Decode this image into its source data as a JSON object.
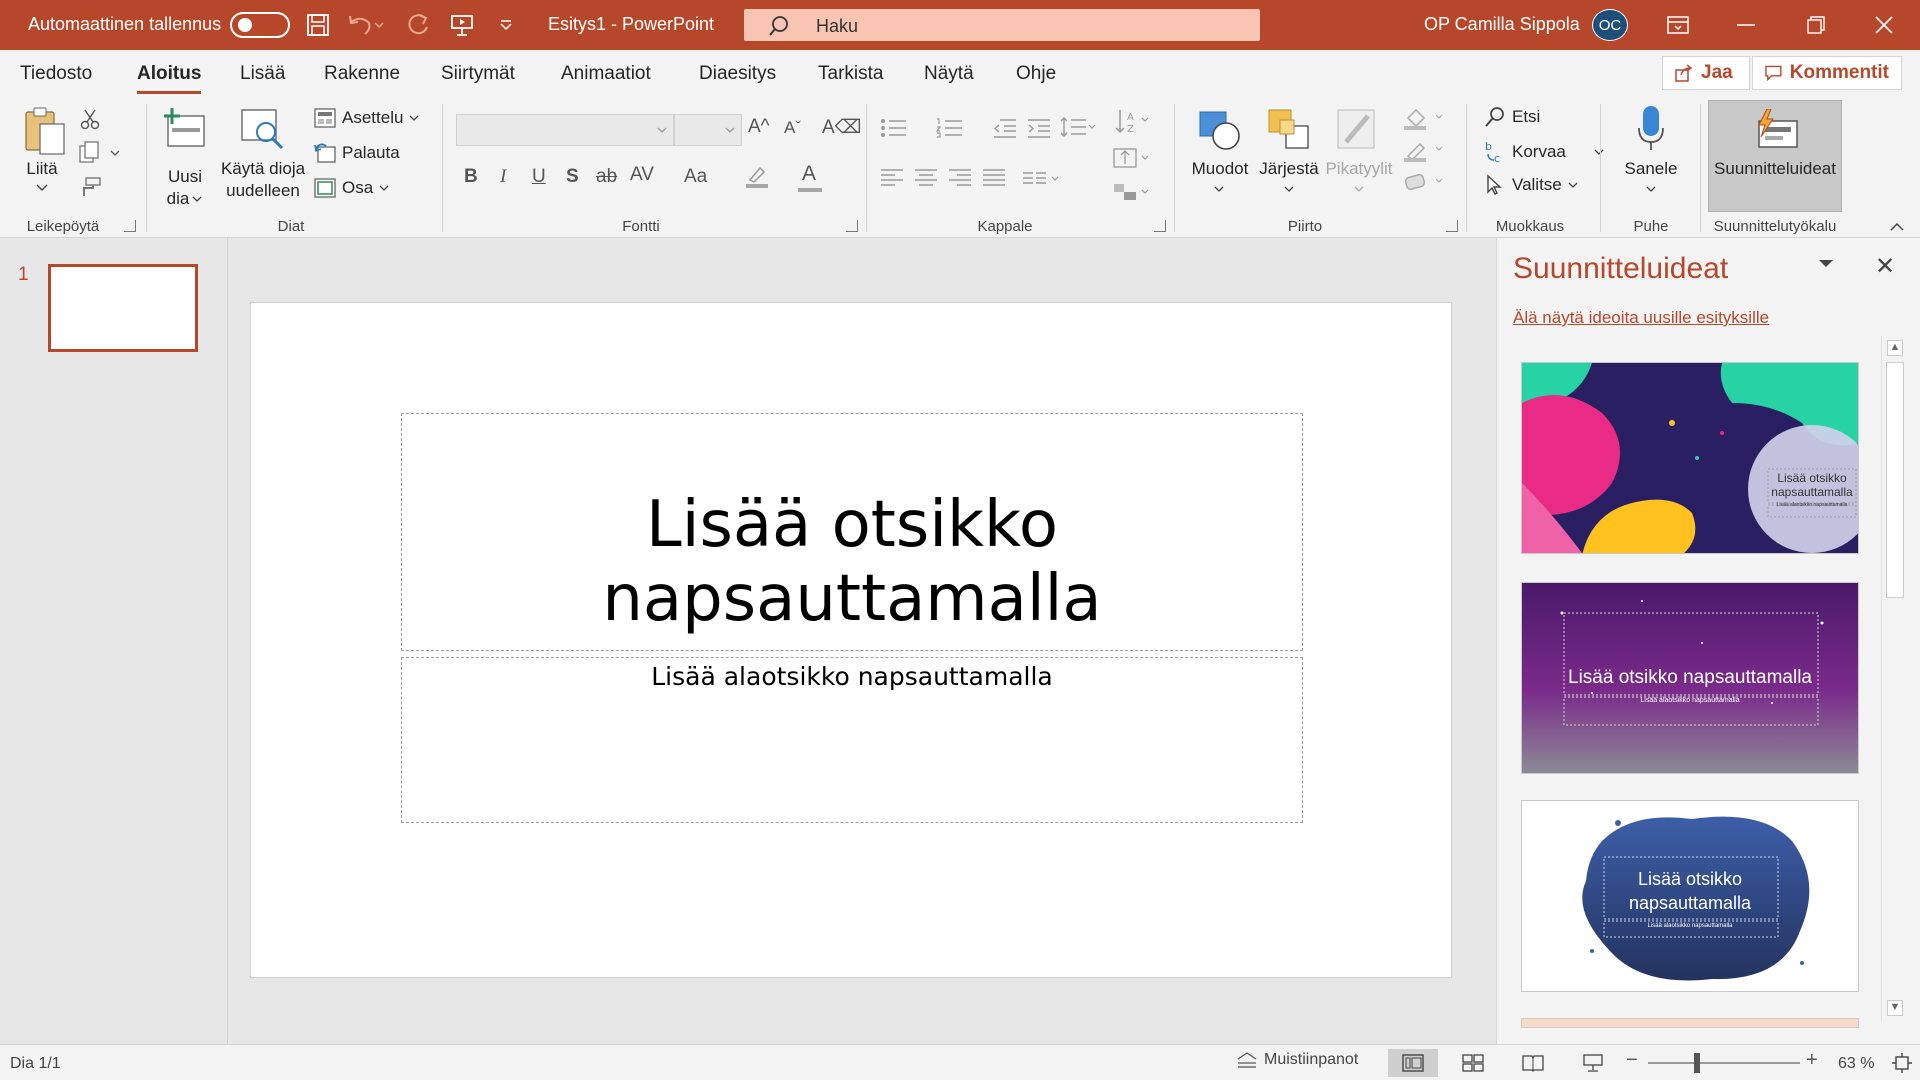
{
  "titlebar": {
    "autosave_label": "Automaattinen tallennus",
    "document_name": "Esitys1  -  PowerPoint",
    "search_placeholder": "Haku",
    "user_name": "OP Camilla Sippola",
    "user_initials": "OC"
  },
  "tabs": [
    "Tiedosto",
    "Aloitus",
    "Lisää",
    "Rakenne",
    "Siirtymät",
    "Animaatiot",
    "Diaesitys",
    "Tarkista",
    "Näytä",
    "Ohje"
  ],
  "active_tab": "Aloitus",
  "actions": {
    "share": "Jaa",
    "comments": "Kommentit"
  },
  "ribbon": {
    "clipboard": {
      "paste": "Liitä",
      "group": "Leikepöytä"
    },
    "slides": {
      "new_slide_1": "Uusi",
      "new_slide_2": "dia",
      "reuse_1": "Käytä dioja",
      "reuse_2": "uudelleen",
      "layout": "Asettelu",
      "reset": "Palauta",
      "section": "Osa",
      "group": "Diat"
    },
    "font": {
      "group": "Fontti"
    },
    "paragraph": {
      "group": "Kappale"
    },
    "drawing": {
      "shapes": "Muodot",
      "arrange": "Järjestä",
      "quick_styles": "Pikatyylit",
      "group": "Piirto"
    },
    "editing": {
      "find": "Etsi",
      "replace": "Korvaa",
      "select": "Valitse",
      "group": "Muokkaus"
    },
    "voice": {
      "dictate": "Sanele",
      "group": "Puhe"
    },
    "designer": {
      "ideas": "Suunnitteluideat",
      "group": "Suunnittelutyökalu"
    }
  },
  "slides_pane": {
    "slide_number": "1"
  },
  "slide": {
    "title_placeholder": "Lisää otsikko napsauttamalla",
    "subtitle_placeholder": "Lisää alaotsikko napsauttamalla"
  },
  "designer_pane": {
    "title": "Suunnitteluideat",
    "dont_show_link": "Älä näytä ideoita uusille esityksille",
    "ideas": [
      {
        "title_1": "Lisää otsikko",
        "title_2": "napsauttamalla",
        "subtitle": "Lisää alaotsikko napsauttamalla"
      },
      {
        "title": "Lisää otsikko napsauttamalla",
        "subtitle": "Lisää alaotsikko napsauttamalla"
      },
      {
        "title_1": "Lisää otsikko",
        "title_2": "napsauttamalla",
        "subtitle": "Lisää alaotsikko napsauttamalla"
      }
    ]
  },
  "statusbar": {
    "slide_info": "Dia 1/1",
    "notes": "Muistiinpanot",
    "zoom": "63 %",
    "zoom_level": 0.63
  },
  "colors": {
    "accent": "#b7472a",
    "search_bg": "#f9c5b3",
    "avatar": "#1f4e79"
  }
}
